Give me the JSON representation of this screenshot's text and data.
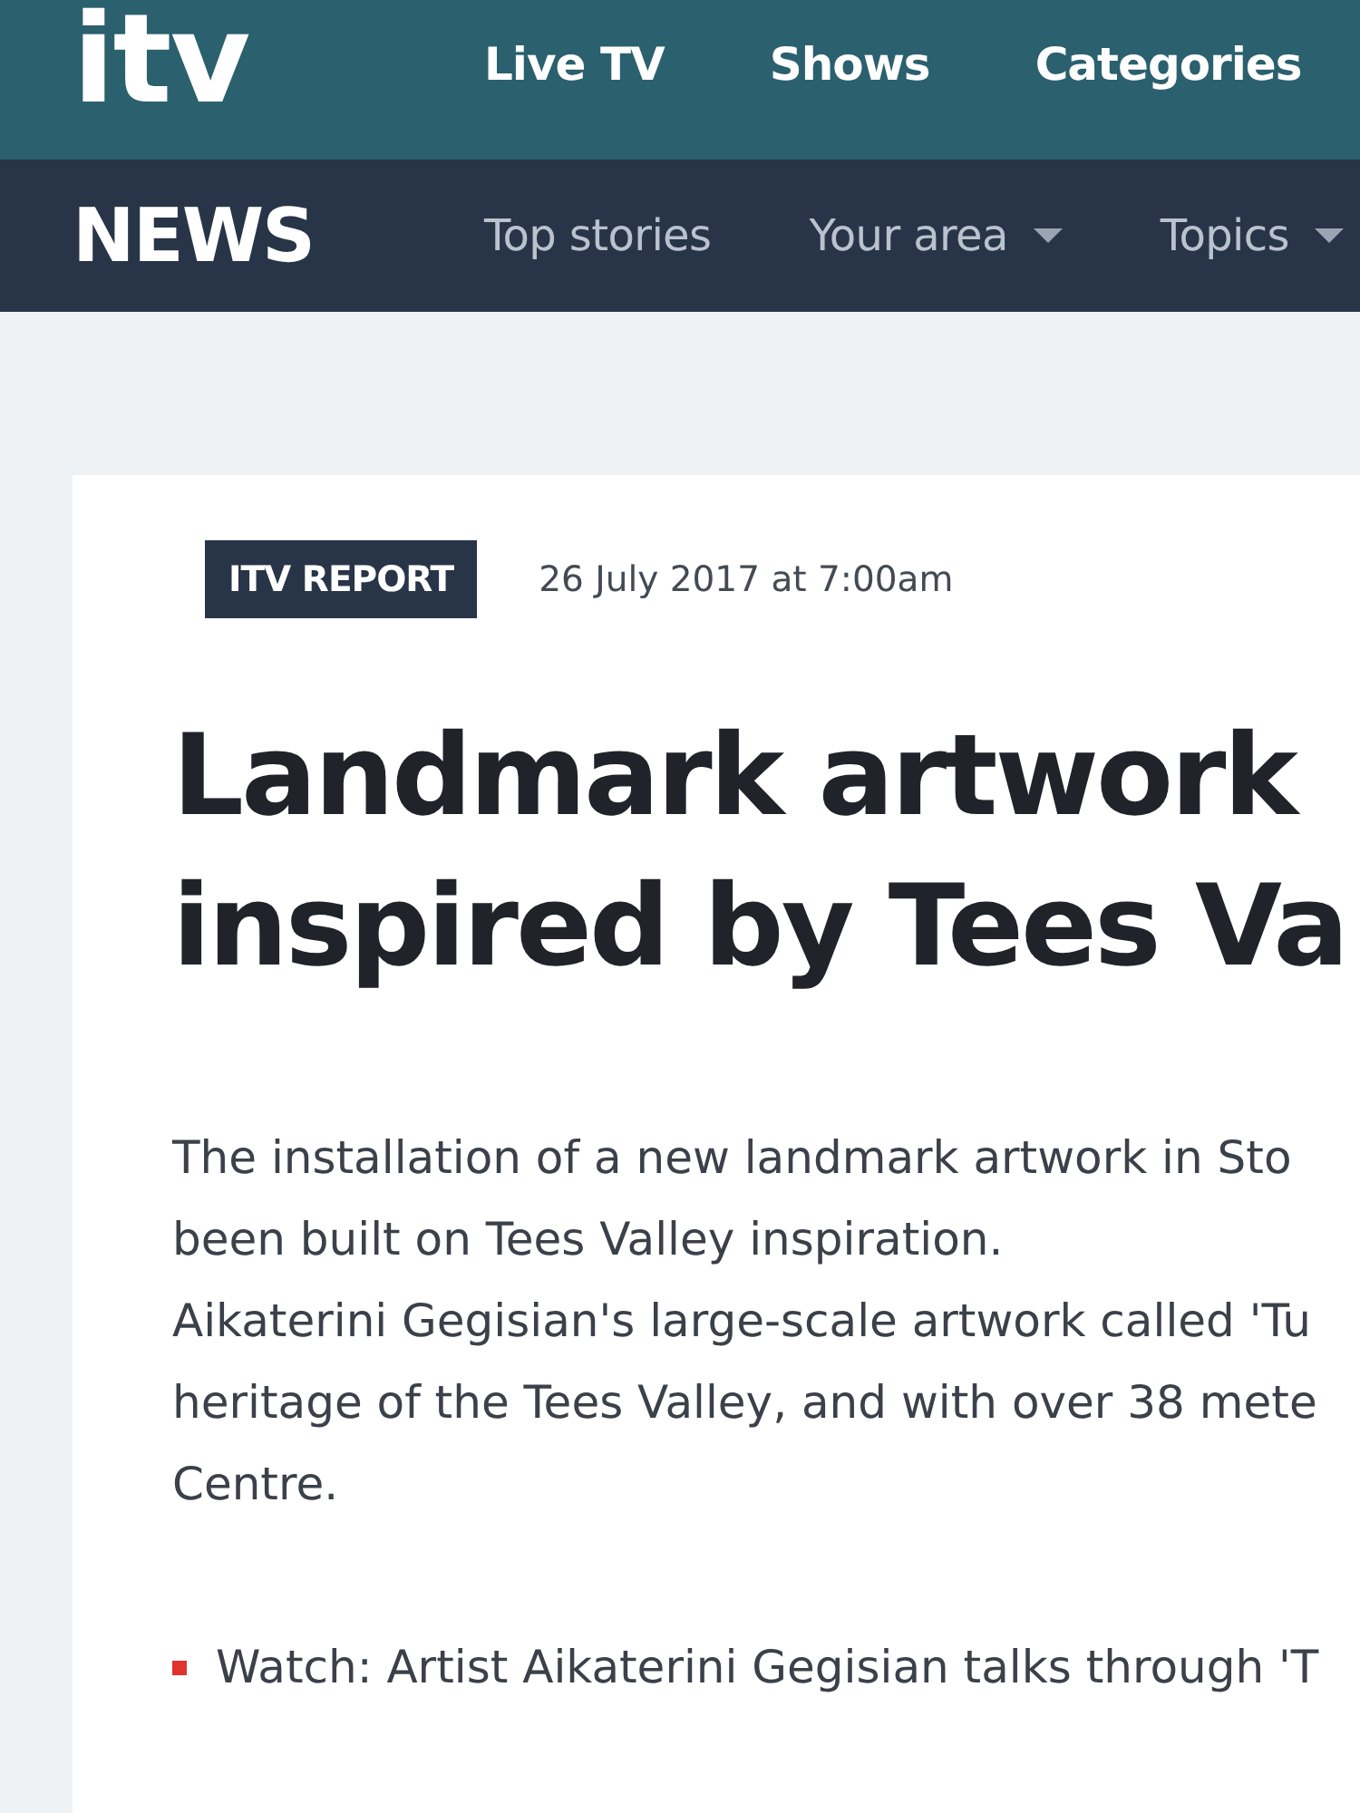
{
  "top_nav": {
    "logo": "itv",
    "items": [
      {
        "label": "Live TV"
      },
      {
        "label": "Shows"
      },
      {
        "label": "Categories"
      }
    ]
  },
  "news_nav": {
    "title": "NEWS",
    "items": [
      {
        "label": "Top stories",
        "dropdown": false
      },
      {
        "label": "Your area",
        "dropdown": true
      },
      {
        "label": "Topics",
        "dropdown": true
      }
    ]
  },
  "article": {
    "badge": "ITV REPORT",
    "date": "26 July 2017 at 7:00am",
    "headline": [
      "Landmark artwork",
      "inspired by Tees Va"
    ],
    "paragraphs": [
      {
        "lines": [
          "The installation of a new landmark artwork in Sto",
          "been built on Tees Valley inspiration."
        ]
      },
      {
        "lines": [
          "Aikaterini Gegisian's large-scale artwork called 'Tu",
          "heritage of the Tees Valley, and with over 38 mete",
          "Centre."
        ]
      }
    ],
    "links": [
      {
        "text": "Watch: Artist Aikaterini Gegisian talks through 'T"
      }
    ]
  }
}
